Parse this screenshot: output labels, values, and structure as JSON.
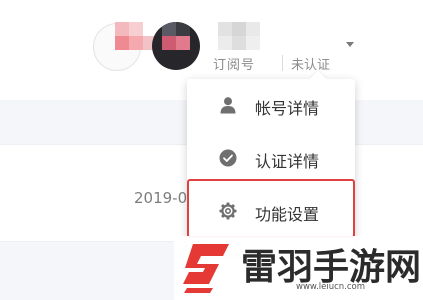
{
  "header": {
    "account_type_label": "订阅号",
    "verification_status": "未认证",
    "dropdown_icon": "caret-down-icon"
  },
  "table": {
    "date_partial": "2019-0"
  },
  "dropdown_menu": {
    "items": [
      {
        "label": "帐号详情",
        "icon": "user-icon"
      },
      {
        "label": "认证详情",
        "icon": "check-circle-icon"
      },
      {
        "label": "功能设置",
        "icon": "gear-icon"
      }
    ],
    "highlighted_item": "功能设置",
    "highlight_color": "#e04040"
  },
  "watermark": {
    "title": "雷羽手游网",
    "url": "www.leiucn.com",
    "emblem_color": "#e53935"
  }
}
